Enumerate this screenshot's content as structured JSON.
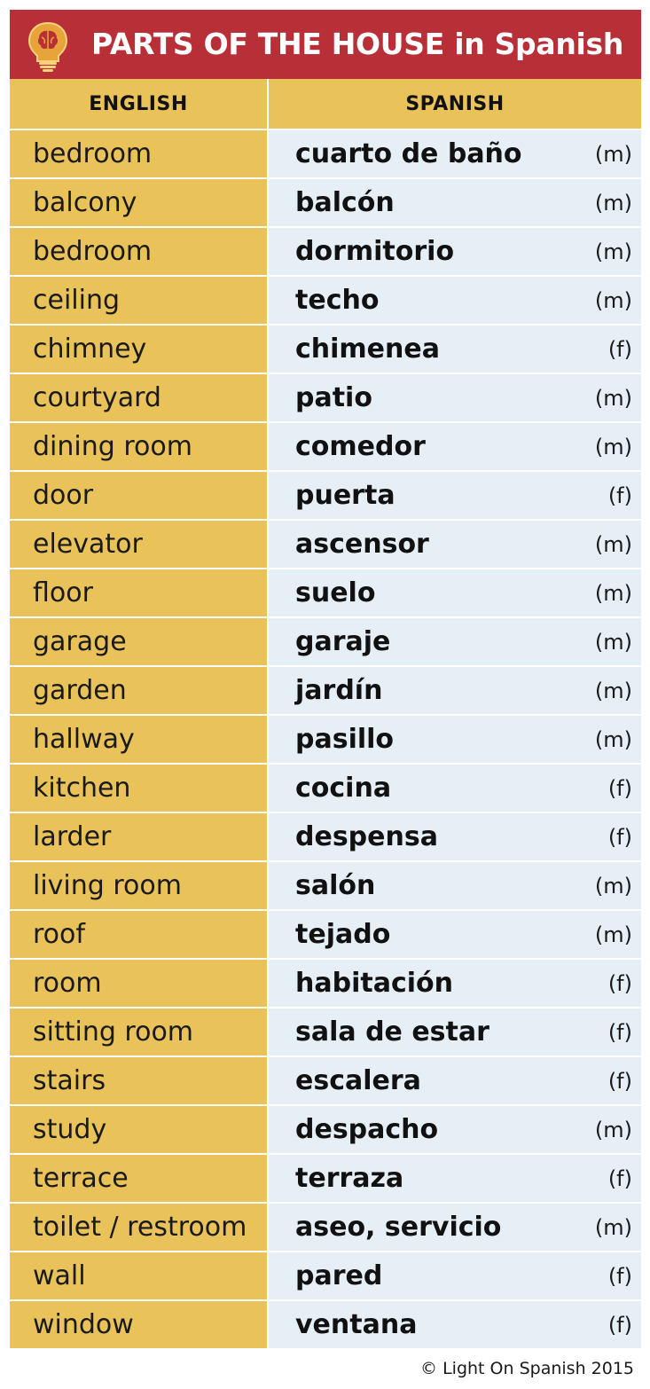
{
  "title": "PARTS OF THE HOUSE in Spanish",
  "logo_icon": "lightbulb-brain-icon",
  "colors": {
    "title_bar": "#b92f37",
    "english_column": "#e9c25a",
    "spanish_column": "#e6eef6",
    "bulb_fill": "#e8a33a"
  },
  "headers": {
    "english": "ENGLISH",
    "spanish": "SPANISH"
  },
  "rows": [
    {
      "english": "bedroom",
      "spanish": "cuarto de baño",
      "gender": "(m)"
    },
    {
      "english": "balcony",
      "spanish": "balcón",
      "gender": "(m)"
    },
    {
      "english": "bedroom",
      "spanish": "dormitorio",
      "gender": "(m)"
    },
    {
      "english": "ceiling",
      "spanish": "techo",
      "gender": "(m)"
    },
    {
      "english": "chimney",
      "spanish": "chimenea",
      "gender": "(f)"
    },
    {
      "english": "courtyard",
      "spanish": "patio",
      "gender": "(m)"
    },
    {
      "english": "dining room",
      "spanish": "comedor",
      "gender": "(m)"
    },
    {
      "english": "door",
      "spanish": "puerta",
      "gender": "(f)"
    },
    {
      "english": "elevator",
      "spanish": "ascensor",
      "gender": "(m)"
    },
    {
      "english": "floor",
      "spanish": "suelo",
      "gender": "(m)"
    },
    {
      "english": "garage",
      "spanish": "garaje",
      "gender": "(m)"
    },
    {
      "english": "garden",
      "spanish": "jardín",
      "gender": "(m)"
    },
    {
      "english": "hallway",
      "spanish": "pasillo",
      "gender": "(m)"
    },
    {
      "english": "kitchen",
      "spanish": "cocina",
      "gender": "(f)"
    },
    {
      "english": "larder",
      "spanish": "despensa",
      "gender": "(f)"
    },
    {
      "english": "living room",
      "spanish": "salón",
      "gender": "(m)"
    },
    {
      "english": "roof",
      "spanish": "tejado",
      "gender": "(m)"
    },
    {
      "english": "room",
      "spanish": "habitación",
      "gender": "(f)"
    },
    {
      "english": "sitting room",
      "spanish": "sala de estar",
      "gender": "(f)"
    },
    {
      "english": "stairs",
      "spanish": "escalera",
      "gender": "(f)"
    },
    {
      "english": "study",
      "spanish": "despacho",
      "gender": "(m)"
    },
    {
      "english": "terrace",
      "spanish": "terraza",
      "gender": "(f)"
    },
    {
      "english": "toilet / restroom",
      "spanish": "aseo, servicio",
      "gender": "(m)"
    },
    {
      "english": "wall",
      "spanish": "pared",
      "gender": "(f)"
    },
    {
      "english": "window",
      "spanish": "ventana",
      "gender": "(f)"
    }
  ],
  "footer": "© Light On Spanish 2015"
}
